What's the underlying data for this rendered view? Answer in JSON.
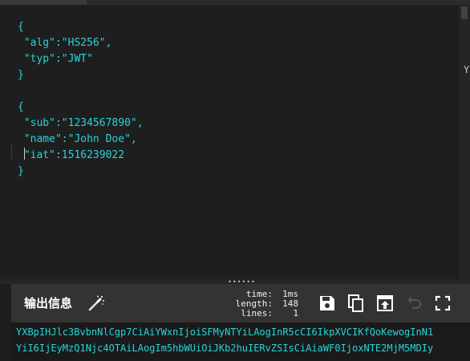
{
  "editor": {
    "header_json": {
      "open": "{",
      "alg_key": "\"alg\"",
      "alg_val": "\"HS256\"",
      "typ_key": "\"typ\"",
      "typ_val": "\"JWT\"",
      "close": "}"
    },
    "payload_json": {
      "open": "{",
      "sub_key": "\"sub\"",
      "sub_val": "\"1234567890\"",
      "name_key": "\"name\"",
      "name_val": "\"John Doe\"",
      "iat_key": "\"iat\"",
      "iat_val": "1516239022",
      "close": "}"
    },
    "colon": ":",
    "comma": ",",
    "edge_glyph": "Y"
  },
  "output": {
    "title": "输出信息",
    "stats": {
      "time_label": "time:",
      "time_value": "1ms",
      "length_label": "length:",
      "length_value": "148",
      "lines_label": "lines:",
      "lines_value": "1"
    },
    "lines": [
      "YXBpIHJlc3BvbnNlCgp7CiAiYWxnIjoiSFMyNTYiLAogInR5cCI6IkpXVCIKfQoKewogInN1",
      "YiI6IjEyMzQ1Njc4OTAiLAogIm5hbWUiOiJKb2huIERvZSIsCiAiaWF0IjoxNTE2MjM5MDIy"
    ]
  },
  "toolbar": {
    "icons": [
      "wand-icon",
      "save-icon",
      "copy-icon",
      "open-in-new-icon",
      "undo-icon",
      "fullscreen-icon"
    ]
  },
  "colors": {
    "code_text": "#2ad4d8",
    "background": "#1e1e1e",
    "panel": "#333333"
  }
}
